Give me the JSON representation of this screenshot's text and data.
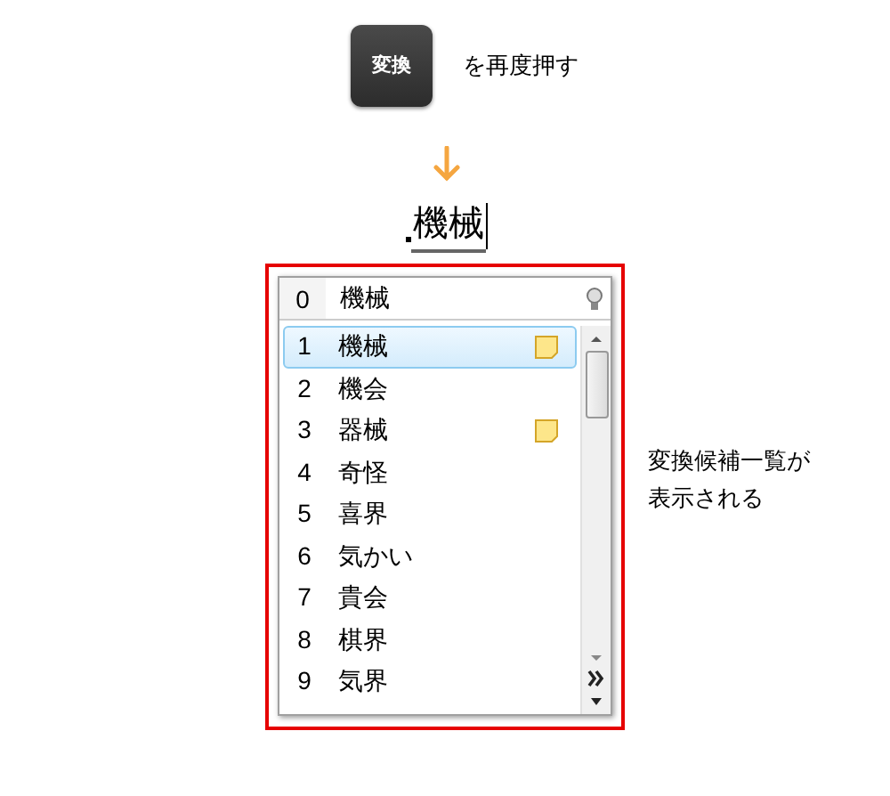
{
  "key": {
    "label": "変換"
  },
  "instruction": "を再度押す",
  "composition": {
    "text": "機械"
  },
  "top_candidate": {
    "number": "0",
    "text": "機械"
  },
  "candidates": [
    {
      "number": "1",
      "text": "機械",
      "selected": true,
      "has_note": true
    },
    {
      "number": "2",
      "text": "機会",
      "selected": false,
      "has_note": false
    },
    {
      "number": "3",
      "text": "器械",
      "selected": false,
      "has_note": true
    },
    {
      "number": "4",
      "text": "奇怪",
      "selected": false,
      "has_note": false
    },
    {
      "number": "5",
      "text": "喜界",
      "selected": false,
      "has_note": false
    },
    {
      "number": "6",
      "text": "気かい",
      "selected": false,
      "has_note": false
    },
    {
      "number": "7",
      "text": "貴会",
      "selected": false,
      "has_note": false
    },
    {
      "number": "8",
      "text": "棋界",
      "selected": false,
      "has_note": false
    },
    {
      "number": "9",
      "text": "気界",
      "selected": false,
      "has_note": false
    }
  ],
  "caption": "変換候補一覧が表示される"
}
